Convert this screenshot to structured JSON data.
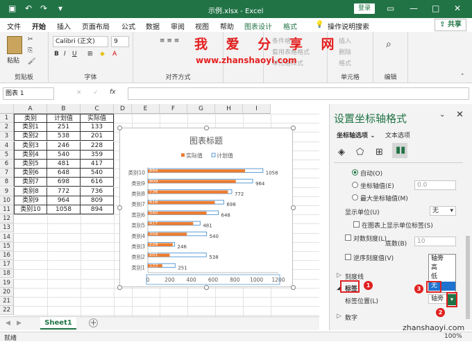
{
  "titlebar": {
    "doc_title": "示例.xlsx - Excel",
    "login": "登录"
  },
  "tabs": [
    "文件",
    "开始",
    "插入",
    "页面布局",
    "公式",
    "数据",
    "审阅",
    "视图",
    "帮助",
    "图表设计",
    "格式"
  ],
  "tell_me": "操作说明搜索",
  "share": "共享",
  "ribbon": {
    "paste": "粘贴",
    "clipboard": "剪贴板",
    "font_name": "Calibri (正文)",
    "font_size": "9",
    "font_group": "字体",
    "align_group": "对齐方式",
    "number_label": "数字",
    "insert": "插入",
    "delete": "删除",
    "format": "格式",
    "cond_format": "条件格式",
    "table_format": "套用表格格式",
    "cell_style": "单元格样式",
    "cells_group": "单元格",
    "edit_group": "编辑"
  },
  "watermark": {
    "title": "我 爱 分 享 网",
    "url": "www.zhanshaoyi.com"
  },
  "formula_bar": {
    "name_box": "图表 1",
    "fx": "fx"
  },
  "columns": [
    "A",
    "B",
    "C",
    "D",
    "E",
    "F",
    "G",
    "H",
    "I"
  ],
  "rows": [
    "1",
    "2",
    "3",
    "4",
    "5",
    "6",
    "7",
    "8",
    "9",
    "10",
    "11",
    "12",
    "13",
    "14",
    "15",
    "16",
    "17",
    "18",
    "19",
    "20",
    "21",
    "22"
  ],
  "table": {
    "header": [
      "类别",
      "计划值",
      "实际值"
    ],
    "data": [
      [
        "类别1",
        "251",
        "133"
      ],
      [
        "类别2",
        "538",
        "201"
      ],
      [
        "类别3",
        "246",
        "228"
      ],
      [
        "类别4",
        "540",
        "359"
      ],
      [
        "类别5",
        "481",
        "417"
      ],
      [
        "类别6",
        "648",
        "540"
      ],
      [
        "类别7",
        "698",
        "616"
      ],
      [
        "类别8",
        "772",
        "736"
      ],
      [
        "类别9",
        "964",
        "809"
      ],
      [
        "类别10",
        "1058",
        "894"
      ]
    ]
  },
  "chart_data": {
    "type": "bar",
    "title": "图表标题",
    "categories": [
      "类别1",
      "类别2",
      "类别3",
      "类别4",
      "类别5",
      "类别6",
      "类别7",
      "类别8",
      "类别9",
      "类别10"
    ],
    "series": [
      {
        "name": "实际值",
        "values": [
          133,
          201,
          228,
          359,
          417,
          540,
          616,
          736,
          809,
          894
        ],
        "color": "#ed7d31"
      },
      {
        "name": "计划值",
        "values": [
          251,
          538,
          246,
          540,
          481,
          648,
          698,
          772,
          964,
          1058
        ],
        "color": "#5b9bd5"
      }
    ],
    "xlim": [
      0,
      1200
    ],
    "xticks": [
      "0",
      "200",
      "400",
      "600",
      "800",
      "1000",
      "1200"
    ],
    "legend": "top",
    "grid": false
  },
  "sheet": {
    "tab": "Sheet1",
    "add": "+"
  },
  "status": {
    "ready": "就绪",
    "zoom": "100%"
  },
  "pane": {
    "title": "设置坐标轴格式",
    "tab_axis": "坐标轴选项",
    "tab_text": "文本选项",
    "auto": "自动(O)",
    "axis_value": "坐标轴值(E)",
    "axis_value_input": "0.0",
    "max_axis": "最大坐标轴值(M)",
    "display_unit": "显示单位(U)",
    "display_unit_val": "无",
    "show_unit": "在图表上显示单位标签(S)",
    "log_scale": "对数刻度(L)",
    "base": "底数(B)",
    "base_val": "10",
    "reverse": "逆序刻度值(V)",
    "tick_marks": "刻度线",
    "labels": "标签",
    "label_pos": "标签位置(L)",
    "label_pos_val": "轴旁",
    "number": "数字",
    "options": [
      "轴旁",
      "高",
      "低",
      "无"
    ],
    "steps": [
      "1",
      "2",
      "3"
    ]
  },
  "footer_wm": "zhanshaoyi.com"
}
